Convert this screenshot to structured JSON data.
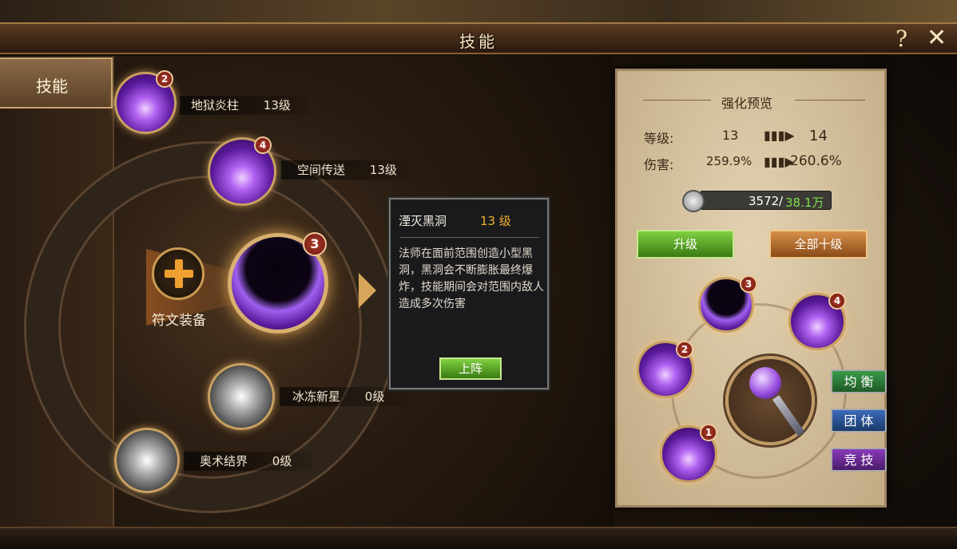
{
  "window": {
    "title": "技能",
    "help_label": "?",
    "close_label": "✕"
  },
  "sidebar": {
    "tabs": [
      {
        "label": "技能"
      }
    ]
  },
  "skills": [
    {
      "name": "地狱炎柱",
      "level": "13级",
      "badge": "2",
      "style": "purple"
    },
    {
      "name": "空间传送",
      "level": "13级",
      "badge": "4",
      "style": "purple"
    },
    {
      "name": "湮灭黑洞",
      "level": "",
      "badge": "3",
      "style": "void"
    },
    {
      "name": "冰冻新星",
      "level": "0级",
      "badge": "",
      "style": "gray"
    },
    {
      "name": "奥术结界",
      "level": "0级",
      "badge": "",
      "style": "gray"
    }
  ],
  "rune": {
    "label": "符文装备"
  },
  "popup": {
    "title": "湮灭黑洞",
    "level": "13 级",
    "description": "法师在面前范围创造小型黑洞，黑洞会不断膨胀最终爆炸，技能期间会对范围内敌人造成多次伤害",
    "deploy_button": "上阵"
  },
  "preview": {
    "heading": "强化预览",
    "level_label": "等级:",
    "level_from": "13",
    "level_to": "14",
    "damage_label": "伤害:",
    "damage_from": "259.9%",
    "damage_to": "260.6%",
    "cost_have": "3572",
    "cost_need": "38.1万",
    "upgrade_button": "升级",
    "upgrade_all_button": "全部十级"
  },
  "loadout": {
    "slots": [
      {
        "badge": "3",
        "style": "void"
      },
      {
        "badge": "4",
        "style": "purple"
      },
      {
        "badge": "2",
        "style": "purple"
      },
      {
        "badge": "1",
        "style": "purple"
      }
    ],
    "modes": [
      {
        "label": "均 衡",
        "color": "#2f7a3a"
      },
      {
        "label": "团 体",
        "color": "#2a5a9a"
      },
      {
        "label": "竞 技",
        "color": "#6a2a9a"
      }
    ]
  },
  "colors": {
    "accent_gold": "#c9a060",
    "level_orange": "#f0b030",
    "cost_green": "#7fe04a"
  }
}
